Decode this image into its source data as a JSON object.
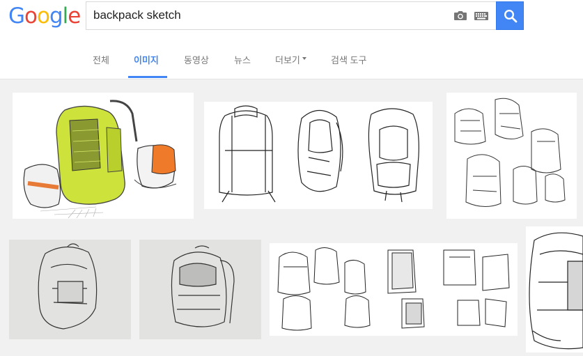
{
  "logo": {
    "text": "Google",
    "letters": [
      "G",
      "o",
      "o",
      "g",
      "l",
      "e"
    ]
  },
  "search": {
    "query": "backpack sketch"
  },
  "icons": {
    "camera": "camera-icon",
    "keyboard": "keyboard-icon",
    "search": "search-icon"
  },
  "tabs": [
    {
      "label": "전체",
      "active": false
    },
    {
      "label": "이미지",
      "active": true
    },
    {
      "label": "동영상",
      "active": false
    },
    {
      "label": "뉴스",
      "active": false
    },
    {
      "label": "더보기",
      "active": false,
      "dropdown": true
    },
    {
      "label": "검색 도구",
      "active": false
    }
  ],
  "colors": {
    "accent": "#4285f4",
    "blue": "#4285f4",
    "red": "#ea4335",
    "yellow": "#fbbc05",
    "green": "#34a853"
  },
  "results": {
    "row1_count": 3,
    "row2_count": 4
  }
}
